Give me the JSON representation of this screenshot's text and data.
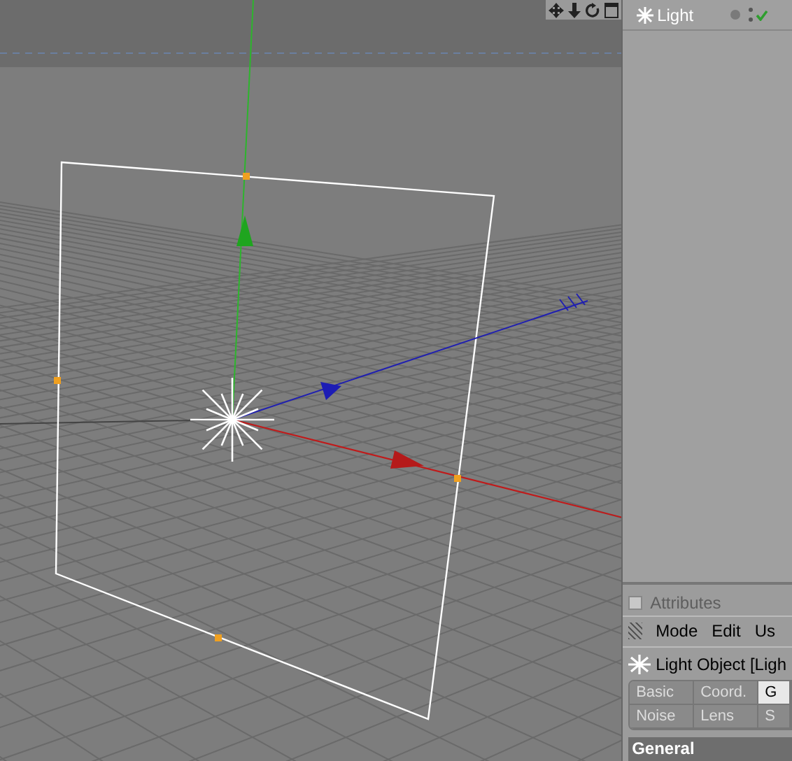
{
  "objects": [
    {
      "name": "Light",
      "visible": true
    }
  ],
  "attributes": {
    "checked": false,
    "title": "Attributes",
    "menu": [
      "Mode",
      "Edit",
      "Us"
    ],
    "object_title": "Light Object [Ligh",
    "tabs": [
      [
        {
          "label": "Basic",
          "selected": false
        },
        {
          "label": "Coord.",
          "selected": false
        },
        {
          "label": "G",
          "selected": true
        }
      ],
      [
        {
          "label": "Noise",
          "selected": false
        },
        {
          "label": "Lens",
          "selected": false
        },
        {
          "label": "S",
          "selected": false
        }
      ]
    ],
    "section": "General"
  }
}
